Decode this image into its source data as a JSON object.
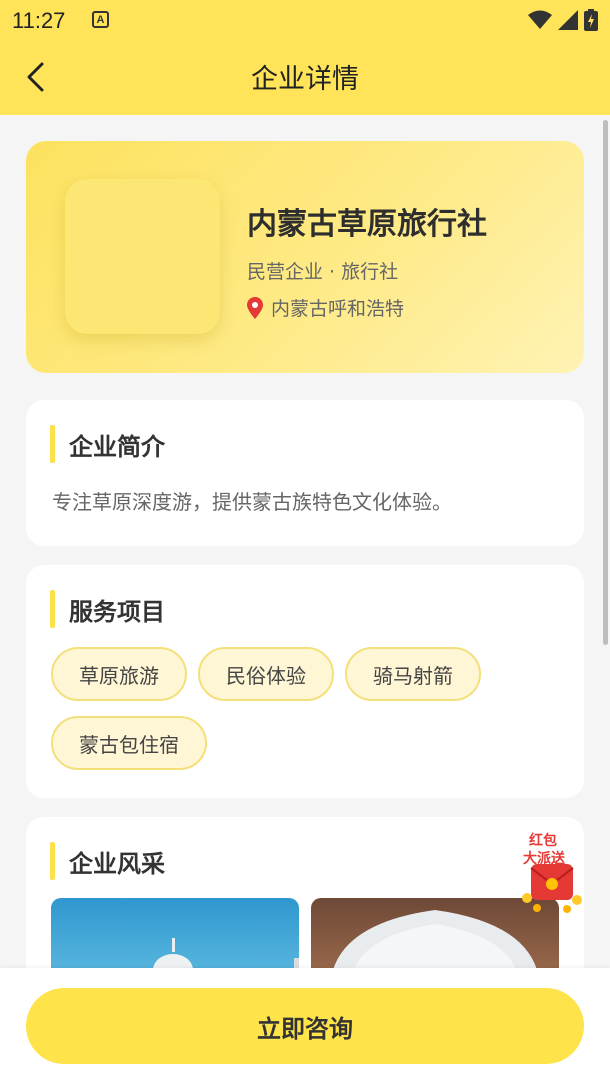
{
  "status_bar": {
    "time": "11:27",
    "notification_badge": "A"
  },
  "nav": {
    "title": "企业详情"
  },
  "company": {
    "name": "内蒙古草原旅行社",
    "type": "民营企业 · 旅行社",
    "location": "内蒙古呼和浩特"
  },
  "intro": {
    "title": "企业简介",
    "text": "专注草原深度游，提供蒙古族特色文化体验。"
  },
  "services": {
    "title": "服务项目",
    "tags": [
      "草原旅游",
      "民俗体验",
      "骑马射箭",
      "蒙古包住宿"
    ]
  },
  "gallery": {
    "title": "企业风采"
  },
  "promo": {
    "line1": "红包",
    "line2": "大派送"
  },
  "action": {
    "consult_label": "立即咨询"
  },
  "colors": {
    "accent": "#ffe34a",
    "tag_bg": "#fff6d6",
    "tag_border": "#f4e07a"
  }
}
